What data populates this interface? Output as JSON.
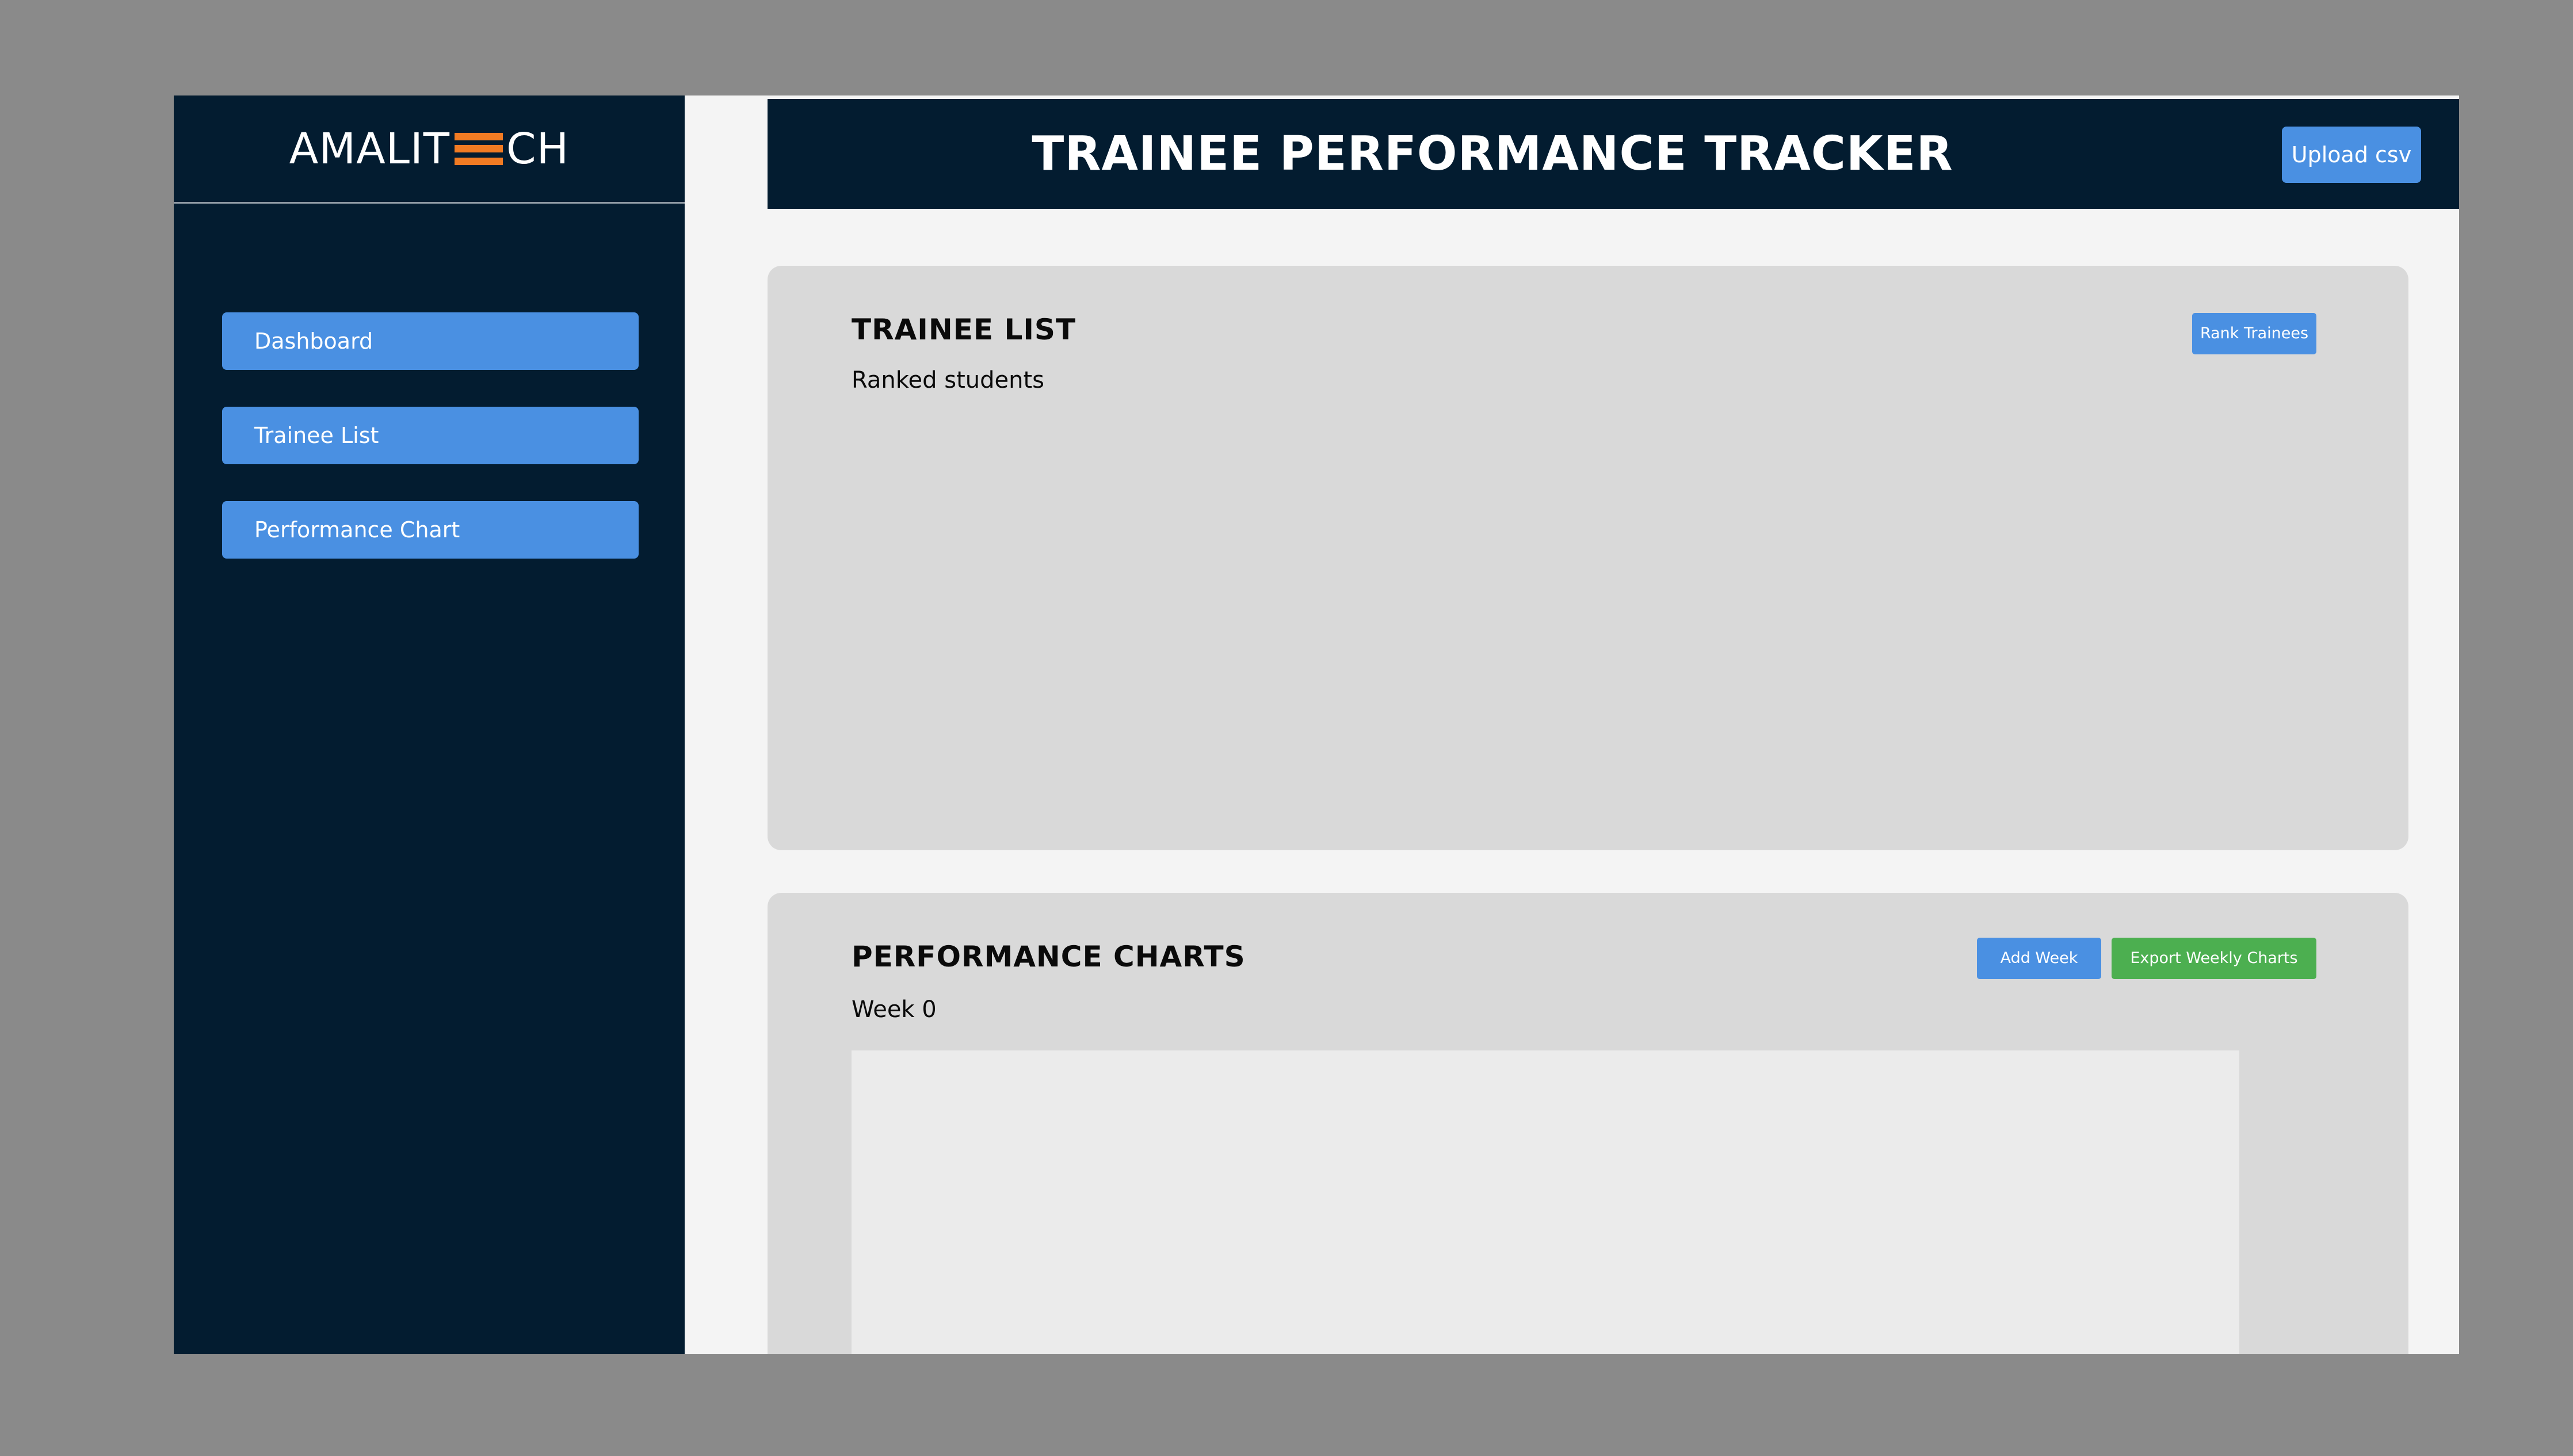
{
  "logo": {
    "text_left": "AMALIT",
    "text_right": "CH",
    "mark_color": "#f17b23"
  },
  "sidebar": {
    "items": [
      {
        "label": "Dashboard"
      },
      {
        "label": "Trainee List"
      },
      {
        "label": "Performance Chart"
      }
    ]
  },
  "header": {
    "title": "TRAINEE PERFORMANCE TRACKER",
    "upload_label": "Upload csv"
  },
  "trainee_list": {
    "title": "TRAINEE LIST",
    "subtitle": "Ranked students",
    "rank_label": "Rank Trainees"
  },
  "performance_charts": {
    "title": "PERFORMANCE CHARTS",
    "week_label": "Week 0",
    "add_week_label": "Add Week",
    "export_label": "Export Weekly Charts"
  },
  "colors": {
    "sidebar_bg": "#031c30",
    "accent_blue": "#4a90e2",
    "accent_green": "#4caf50",
    "card_bg": "#d9d9d9"
  }
}
